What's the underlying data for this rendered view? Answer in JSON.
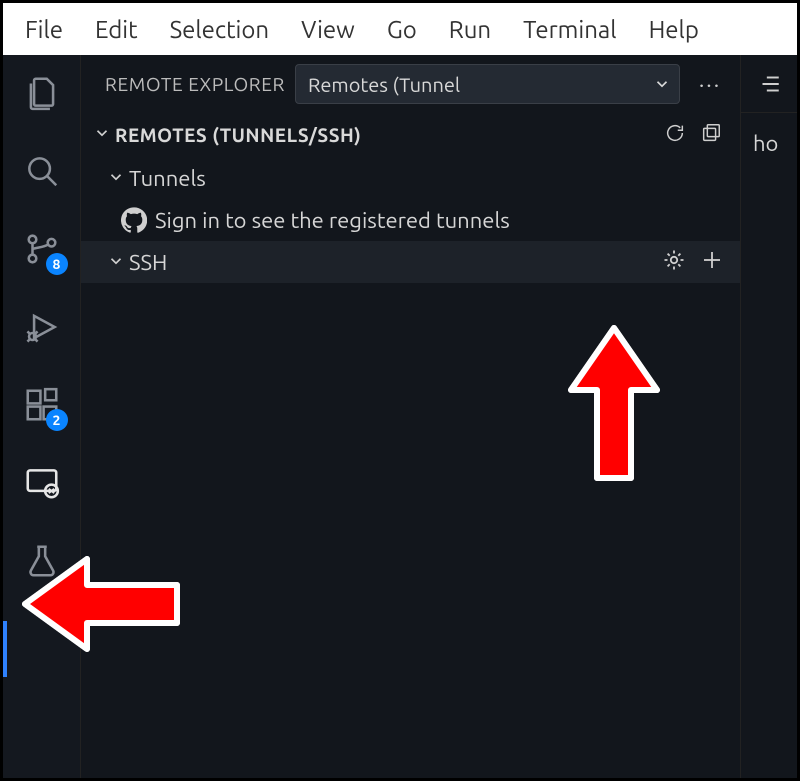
{
  "menubar": {
    "items": [
      "File",
      "Edit",
      "Selection",
      "View",
      "Go",
      "Run",
      "Terminal",
      "Help"
    ]
  },
  "activitybar": {
    "explorer": "Explorer",
    "search": "Search",
    "scm": "Source Control",
    "scm_badge": "8",
    "run": "Run and Debug",
    "extensions": "Extensions",
    "extensions_badge": "2",
    "remote": "Remote Explorer",
    "testing": "Testing"
  },
  "sidebar": {
    "title": "REMOTE EXPLORER",
    "dropdown": {
      "value": "Remotes (Tunnel"
    },
    "more": "···",
    "section": {
      "label": "REMOTES (TUNNELS/SSH)",
      "refresh": "Refresh",
      "newwin": "Open in New Window"
    },
    "tree": {
      "tunnels": {
        "label": "Tunnels"
      },
      "signin": {
        "label": "Sign in to see the registered tunnels"
      },
      "ssh": {
        "label": "SSH",
        "settings": "Open SSH Config",
        "add": "New Remote"
      }
    }
  },
  "editor": {
    "breadcrumb": "ho"
  },
  "annotations": {
    "arrow_up": "points at New Remote (+) button",
    "arrow_left": "points at Remote Explorer activity bar icon"
  }
}
